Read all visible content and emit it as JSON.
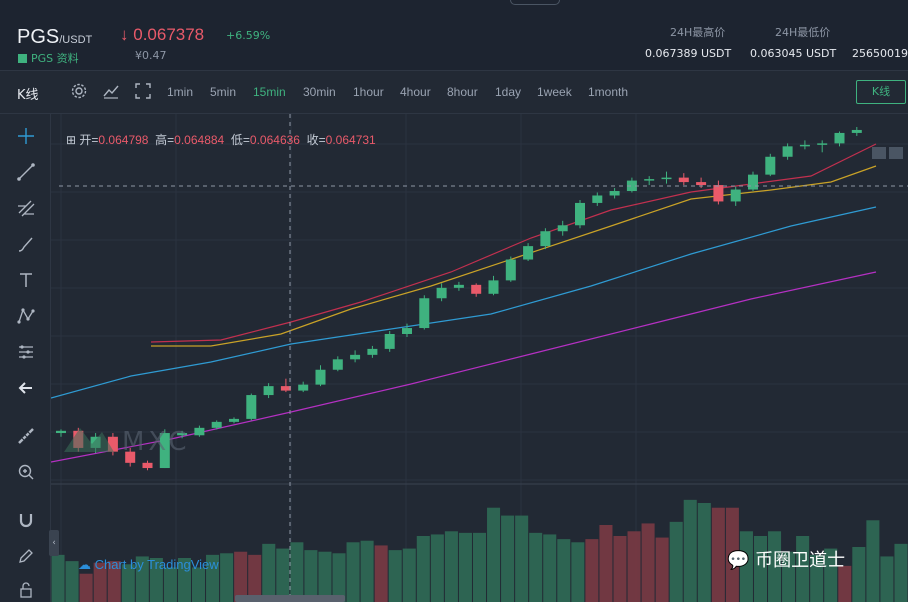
{
  "header": {
    "pair": "PGS",
    "quote": "/USDT",
    "link_label": "PGS 资料",
    "price": "0.067378",
    "change": "+6.59%",
    "cny": "¥0.47",
    "stats": [
      {
        "label": "24H最高价",
        "value": "0.067389 USDT"
      },
      {
        "label": "24H最低价",
        "value": "0.063045 USDT"
      },
      {
        "label": "",
        "value": "25650019"
      }
    ]
  },
  "toolbar": {
    "kline_label": "K线",
    "intervals": [
      "1min",
      "5min",
      "15min",
      "30min",
      "1hour",
      "4hour",
      "8hour",
      "1day",
      "1week",
      "1month"
    ],
    "active_interval": "15min",
    "kline_button": "K线"
  },
  "ohlc": {
    "open_label": "开=",
    "open": "0.064798",
    "high_label": "高=",
    "high": "0.064884",
    "low_label": "低=",
    "low": "0.064636",
    "close_label": "收=",
    "close": "0.064731"
  },
  "watermark": {
    "brand": "MXC"
  },
  "credit": "Chart by TradingView",
  "overlay_brand": "币圈卫道士",
  "colors": {
    "up": "#3fb27f",
    "down": "#e95a6a",
    "ma_short": "#c9a227",
    "ma_mid": "#2f9bd3",
    "ma_long": "#b530c3",
    "ma_fast": "#c2304f",
    "accent": "#3fb27f",
    "background": "#222934"
  },
  "icons": {
    "tools": [
      "crosshair-icon",
      "trend-line-icon",
      "fib-icon",
      "brush-icon",
      "text-icon",
      "pattern-icon",
      "measure-icon",
      "back-arrow-icon",
      "ruler-icon",
      "zoom-icon",
      "magnet-icon",
      "pencil-lock-icon",
      "lock-icon"
    ]
  },
  "chart_data": {
    "type": "candlestick",
    "candles": [
      [
        0.06345,
        0.0635,
        0.0634,
        0.06348,
        "up"
      ],
      [
        0.06348,
        0.06352,
        0.0632,
        0.06325,
        "down"
      ],
      [
        0.06325,
        0.06345,
        0.06318,
        0.0634,
        "up"
      ],
      [
        0.0634,
        0.06345,
        0.06315,
        0.0632,
        "down"
      ],
      [
        0.0632,
        0.06325,
        0.063,
        0.06305,
        "down"
      ],
      [
        0.06305,
        0.06308,
        0.06295,
        0.06298,
        "down"
      ],
      [
        0.06298,
        0.0635,
        0.06298,
        0.06345,
        "up"
      ],
      [
        0.06345,
        0.06348,
        0.06338,
        0.06342,
        "up"
      ],
      [
        0.06342,
        0.06355,
        0.0634,
        0.06352,
        "up"
      ],
      [
        0.06352,
        0.06362,
        0.0635,
        0.0636,
        "up"
      ],
      [
        0.0636,
        0.06366,
        0.06358,
        0.06364,
        "up"
      ],
      [
        0.06364,
        0.06398,
        0.06362,
        0.06396,
        "up"
      ],
      [
        0.06396,
        0.06412,
        0.06392,
        0.06408,
        "up"
      ],
      [
        0.06408,
        0.06418,
        0.064,
        0.06402,
        "down"
      ],
      [
        0.06402,
        0.06414,
        0.064,
        0.0641,
        "up"
      ],
      [
        0.0641,
        0.06436,
        0.06408,
        0.0643,
        "up"
      ],
      [
        0.0643,
        0.06448,
        0.06428,
        0.06444,
        "up"
      ],
      [
        0.06444,
        0.06456,
        0.0644,
        0.0645,
        "up"
      ],
      [
        0.0645,
        0.06462,
        0.06446,
        0.06458,
        "up"
      ],
      [
        0.06458,
        0.06482,
        0.06454,
        0.06478,
        "up"
      ],
      [
        0.06478,
        0.06492,
        0.06474,
        0.06486,
        "up"
      ],
      [
        0.06486,
        0.0653,
        0.06484,
        0.06526,
        "up"
      ],
      [
        0.06526,
        0.06546,
        0.06522,
        0.0654,
        "up"
      ],
      [
        0.0654,
        0.06548,
        0.06536,
        0.06544,
        "up"
      ],
      [
        0.06544,
        0.06546,
        0.06528,
        0.06532,
        "down"
      ],
      [
        0.06532,
        0.06556,
        0.0653,
        0.0655,
        "up"
      ],
      [
        0.0655,
        0.06582,
        0.06548,
        0.06578,
        "up"
      ],
      [
        0.06578,
        0.066,
        0.06576,
        0.06596,
        "up"
      ],
      [
        0.06596,
        0.0662,
        0.06592,
        0.06616,
        "up"
      ],
      [
        0.06616,
        0.0663,
        0.0661,
        0.06624,
        "up"
      ],
      [
        0.06624,
        0.06658,
        0.0662,
        0.06654,
        "up"
      ],
      [
        0.06654,
        0.06668,
        0.0665,
        0.06664,
        "up"
      ],
      [
        0.06664,
        0.06674,
        0.0666,
        0.0667,
        "up"
      ],
      [
        0.0667,
        0.06688,
        0.06668,
        0.06684,
        "up"
      ],
      [
        0.06684,
        0.0669,
        0.06678,
        0.06686,
        "up"
      ],
      [
        0.06686,
        0.06696,
        0.0668,
        0.06688,
        "up"
      ],
      [
        0.06688,
        0.06694,
        0.06678,
        0.06682,
        "down"
      ],
      [
        0.06682,
        0.06688,
        0.06674,
        0.06678,
        "down"
      ],
      [
        0.06678,
        0.06684,
        0.06652,
        0.06656,
        "down"
      ],
      [
        0.06656,
        0.06676,
        0.0665,
        0.06672,
        "up"
      ],
      [
        0.06672,
        0.06696,
        0.0667,
        0.06692,
        "up"
      ],
      [
        0.06692,
        0.0672,
        0.0669,
        0.06716,
        "up"
      ],
      [
        0.06716,
        0.06734,
        0.06712,
        0.0673,
        "up"
      ],
      [
        0.0673,
        0.06738,
        0.06726,
        0.06732,
        "up"
      ],
      [
        0.06732,
        0.06738,
        0.06722,
        0.06734,
        "up"
      ],
      [
        0.06734,
        0.0675,
        0.0673,
        0.06748,
        "up"
      ],
      [
        0.06748,
        0.06756,
        0.06744,
        0.06752,
        "up"
      ]
    ],
    "volume": [
      30,
      26,
      18,
      25,
      26,
      24,
      29,
      28,
      22,
      28,
      22,
      30,
      31,
      32,
      30,
      37,
      34,
      38,
      33,
      32,
      31,
      38,
      39,
      36,
      33,
      34,
      42,
      43,
      45,
      44,
      44,
      60,
      55,
      55,
      44,
      43,
      40,
      38,
      40,
      49,
      42,
      45,
      50,
      41,
      51,
      65,
      63,
      60,
      60,
      45,
      42,
      45,
      32,
      42,
      30,
      34,
      23,
      35,
      52,
      29,
      37
    ]
  }
}
